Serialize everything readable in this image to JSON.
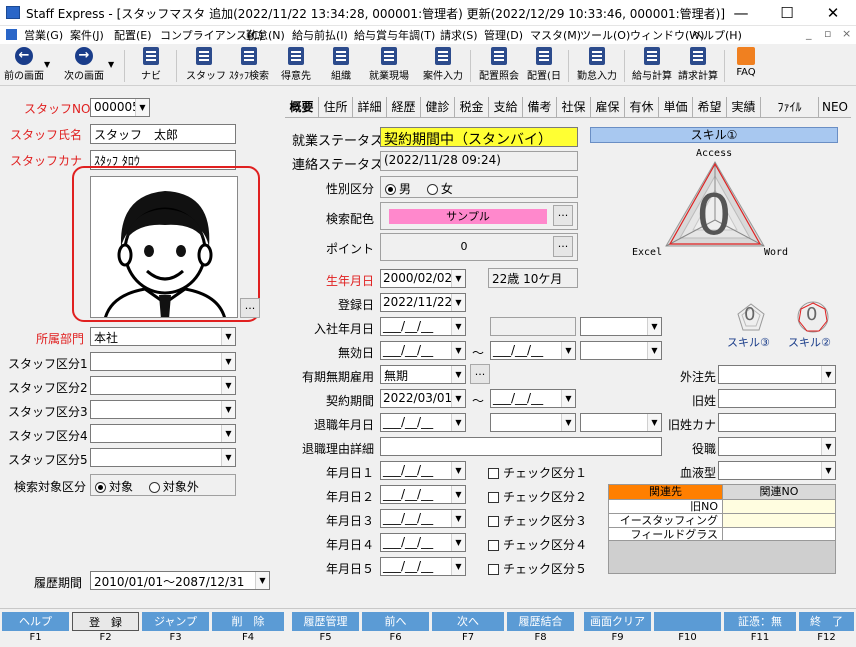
{
  "window": {
    "title": "Staff Express - [スタッフマスタ 追加(2022/11/22 13:34:28, 000001:管理者) 更新(2022/12/29 10:33:46, 000001:管理者)]",
    "minimize": "—",
    "maximize": "☐",
    "close": "✕"
  },
  "menu": [
    "営業(G)",
    "案件(J)",
    "配置(E)",
    "コンプライアンス(C)",
    "勤怠(N)",
    "給与前払(I)",
    "給与賞与年調(T)",
    "請求(S)",
    "管理(D)",
    "マスタ(M)",
    "ツール(O)",
    "ウィンドウ(W)",
    "ヘルプ(H)"
  ],
  "toolbar": {
    "prev": "前の画面",
    "next": "次の画面",
    "navi": "ナビ",
    "staff": "スタッフ",
    "staff_search": "ｽﾀｯﾌ検索",
    "client": "得意先",
    "org": "組織",
    "site": "就業現場",
    "case_entry": "案件入力",
    "placement_inquiry": "配置照会",
    "placement_day": "配置(日",
    "attendance": "勤怠入力",
    "payroll": "給与計算",
    "billing": "請求計算",
    "faq": "FAQ"
  },
  "left": {
    "staff_no_label": "スタッフNO",
    "staff_no": "000005",
    "staff_name_label": "スタッフ氏名",
    "staff_name": "スタッフ　太郎",
    "staff_kana_label": "スタッフカナ",
    "staff_kana": "ｽﾀｯﾌ ﾀﾛｳ",
    "photo_button": "...",
    "dept_label": "所属部門",
    "dept": "本社",
    "kubun_labels": [
      "スタッフ区分1",
      "スタッフ区分2",
      "スタッフ区分3",
      "スタッフ区分4",
      "スタッフ区分5"
    ],
    "search_target_label": "検索対象区分",
    "search_target_on": "対象",
    "search_target_off": "対象外",
    "history_label": "履歴期間",
    "history_value": "2010/01/01～2087/12/31"
  },
  "tabs": [
    "概要",
    "住所",
    "詳細",
    "経歴",
    "健診",
    "税金",
    "支給",
    "備考",
    "社保",
    "雇保",
    "有休",
    "単価",
    "希望",
    "実績",
    "ﾌｧｲﾙ",
    "NEO"
  ],
  "main": {
    "employment_status_label": "就業ステータス",
    "employment_status": "契約期間中（スタンバイ）",
    "contact_status_label": "連絡ステータス",
    "contact_status": "(2022/11/28 09:24)",
    "gender_label": "性別区分",
    "gender_male": "男",
    "gender_female": "女",
    "search_color_label": "検索配色",
    "search_color_value": "サンプル",
    "search_color_btn": "...",
    "point_label": "ポイント",
    "point_value": "0",
    "point_btn": "...",
    "birth_label": "生年月日",
    "birth_value": "2000/02/02",
    "age_value": "22歳 10ケ月",
    "reg_label": "登録日",
    "reg_value": "2022/11/22",
    "join_label": "入社年月日",
    "blank_date": "___/__/__",
    "invalid_label": "無効日",
    "tilde": "～",
    "term_emp_label": "有期無期雇用",
    "term_emp_value": "無期",
    "term_emp_btn": "...",
    "contract_label": "契約期間",
    "contract_value": "2022/03/01",
    "retire_label": "退職年月日",
    "retire_reason_label": "退職理由詳細",
    "ymd_labels": [
      "年月日１",
      "年月日２",
      "年月日３",
      "年月日４",
      "年月日５"
    ],
    "check_labels": [
      "チェック区分１",
      "チェック区分２",
      "チェック区分３",
      "チェック区分４",
      "チェック区分５"
    ],
    "outsource_label": "外注先",
    "old_name_label": "旧姓",
    "old_kana_label": "旧姓カナ",
    "position_label": "役職",
    "blood_label": "血液型"
  },
  "skill": {
    "header": "スキル①",
    "top": "Access",
    "left": "Excel",
    "right": "Word",
    "value": "0",
    "skill3": "スキル③",
    "skill2": "スキル②",
    "small3_value": "0",
    "small2_value": "0",
    "accent": "#a8c8f0"
  },
  "related": {
    "header1": "関連先",
    "header2": "関連NO",
    "rows": [
      "旧NO",
      "イースタッフィング",
      "フィールドグラス"
    ],
    "header_color": "#ff7f00"
  },
  "fkeys": {
    "labels": [
      "ヘルプ",
      "登　録",
      "ジャンプ",
      "削　除",
      "履歴管理",
      "前へ",
      "次へ",
      "履歴結合",
      "画面クリア",
      "",
      "証憑：無",
      "終　了"
    ],
    "nums": [
      "F1",
      "F2",
      "F3",
      "F4",
      "F5",
      "F6",
      "F7",
      "F8",
      "F9",
      "F10",
      "F11",
      "F12"
    ]
  }
}
